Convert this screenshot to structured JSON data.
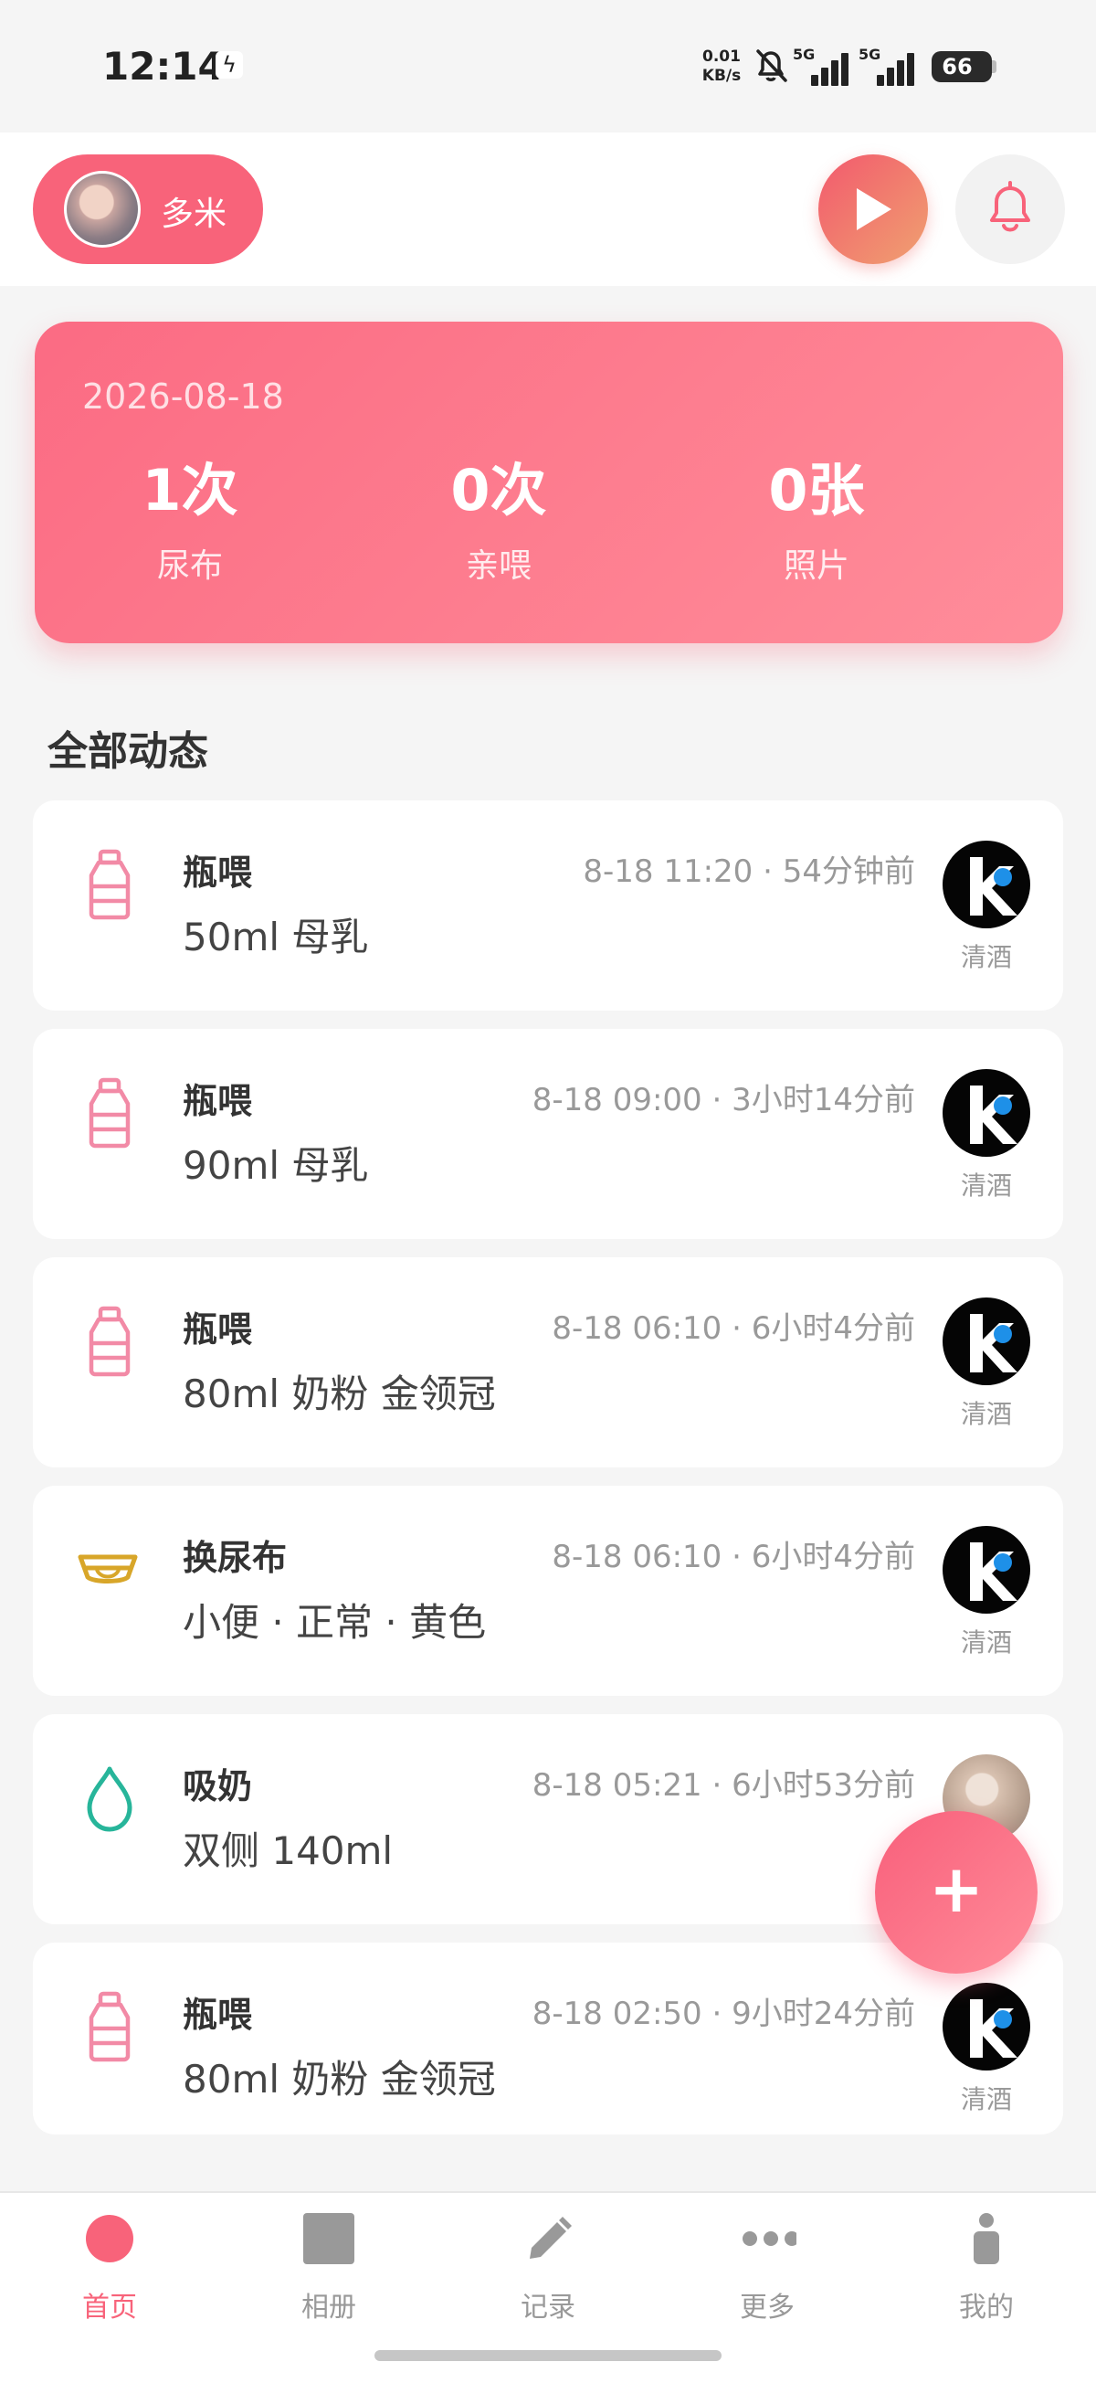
{
  "status_bar": {
    "time": "12:14",
    "speed_value": "0.01",
    "speed_unit": "KB/s",
    "network_1": "5G",
    "network_2": "5G",
    "battery": "66"
  },
  "header": {
    "baby_name": "多米"
  },
  "summary": {
    "date": "2026-08-18",
    "stats": [
      {
        "value": "1次",
        "label": "尿布"
      },
      {
        "value": "0次",
        "label": "亲喂"
      },
      {
        "value": "0张",
        "label": "照片"
      }
    ]
  },
  "section_title": "全部动态",
  "feed": [
    {
      "icon": "bottle-icon",
      "title": "瓶喂",
      "time": "8-18 11:20 · 54分钟前",
      "detail": "50ml 母乳",
      "user": "清酒"
    },
    {
      "icon": "bottle-icon",
      "title": "瓶喂",
      "time": "8-18 09:00 · 3小时14分前",
      "detail": "90ml 母乳",
      "user": "清酒"
    },
    {
      "icon": "bottle-icon",
      "title": "瓶喂",
      "time": "8-18 06:10 · 6小时4分前",
      "detail": "80ml 奶粉 金领冠",
      "user": "清酒"
    },
    {
      "icon": "diaper-icon",
      "title": "换尿布",
      "time": "8-18 06:10 · 6小时4分前",
      "detail": "小便 · 正常 · 黄色",
      "user": "清酒"
    },
    {
      "icon": "drop-icon",
      "title": "吸奶",
      "time": "8-18 05:21 · 6小时53分前",
      "detail": "双侧 140ml",
      "user": ""
    },
    {
      "icon": "bottle-icon",
      "title": "瓶喂",
      "time": "8-18 02:50 · 9小时24分前",
      "detail": "80ml 奶粉 金领冠",
      "user": "清酒"
    }
  ],
  "fab": {
    "label": "+"
  },
  "tabs": [
    {
      "label": "首页",
      "icon": "home-dot-icon",
      "active": true
    },
    {
      "label": "相册",
      "icon": "album-icon",
      "active": false
    },
    {
      "label": "记录",
      "icon": "pencil-icon",
      "active": false
    },
    {
      "label": "更多",
      "icon": "more-dots-icon",
      "active": false
    },
    {
      "label": "我的",
      "icon": "person-icon",
      "active": false
    }
  ],
  "colors": {
    "accent": "#f8637a",
    "card_gradient_start": "#fb6b83",
    "card_gradient_end": "#ff8d9a",
    "bottle_icon": "#f28aa6",
    "diaper_icon": "#d8a629",
    "drop_icon": "#27b59a"
  }
}
